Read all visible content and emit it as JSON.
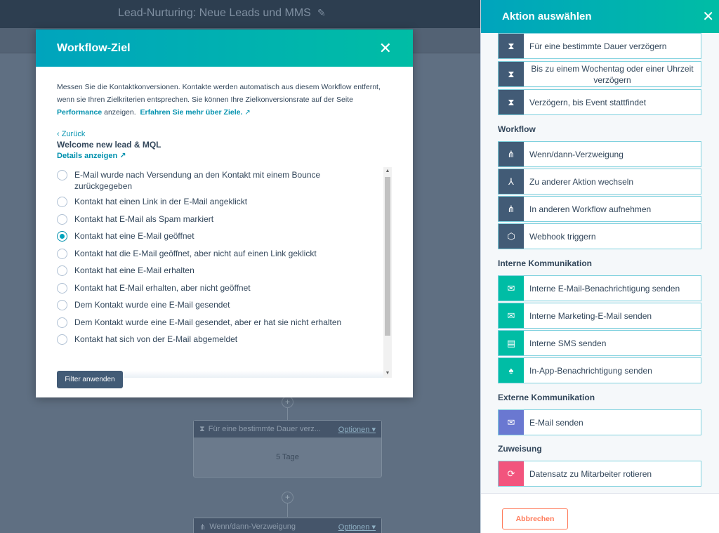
{
  "app": {
    "workflow_title": "Lead-Nurturing: Neue Leads und MMS",
    "edit_icon": "pencil-icon"
  },
  "canvas": {
    "cards": [
      {
        "icon": "hourglass-icon",
        "title": "Für eine bestimmte Dauer verz...",
        "options_label": "Optionen ▾",
        "body": "5 Tage"
      },
      {
        "icon": "branch-icon",
        "title": "Wenn/dann-Verzweigung",
        "options_label": "Optionen ▾",
        "body": ""
      }
    ],
    "plus_glyph": "+"
  },
  "modal": {
    "title": "Workflow-Ziel",
    "close_glyph": "✕",
    "intro_part1": "Messen Sie die Kontaktkonversionen. Kontakte werden automatisch aus diesem Workflow entfernt, wenn sie Ihren Zielkriterien entsprechen. Sie können Ihre Zielkonversionsrate auf der Seite ",
    "performance_link": "Performance",
    "intro_part2": " anzeigen.",
    "learn_more_link": "Erfahren Sie mehr über Ziele.",
    "back_link": "‹ Zurück",
    "goal_name": "Welcome new lead & MQL",
    "details_link": "Details anzeigen",
    "options": [
      {
        "label": "E-Mail wurde nach Versendung an den Kontakt mit einem Bounce zurückgegeben",
        "checked": false
      },
      {
        "label": "Kontakt hat einen Link in der E-Mail angeklickt",
        "checked": false
      },
      {
        "label": "Kontakt hat E-Mail als Spam markiert",
        "checked": false
      },
      {
        "label": "Kontakt hat eine E-Mail geöffnet",
        "checked": true
      },
      {
        "label": "Kontakt hat die E-Mail geöffnet, aber nicht auf einen Link geklickt",
        "checked": false
      },
      {
        "label": "Kontakt hat eine E-Mail erhalten",
        "checked": false
      },
      {
        "label": "Kontakt hat E-Mail erhalten, aber nicht geöffnet",
        "checked": false
      },
      {
        "label": "Dem Kontakt wurde eine E-Mail gesendet",
        "checked": false
      },
      {
        "label": "Dem Kontakt wurde eine E-Mail gesendet, aber er hat sie nicht erhalten",
        "checked": false
      },
      {
        "label": "Kontakt hat sich von der E-Mail abgemeldet",
        "checked": false
      }
    ],
    "apply_button": "Filter anwenden"
  },
  "panel": {
    "title": "Aktion auswählen",
    "close_glyph": "✕",
    "delay_actions": [
      {
        "label": "Für eine bestimmte Dauer verzögern",
        "icon": "hourglass-icon",
        "glyph": "⧗",
        "style": "dark"
      },
      {
        "label": "Bis zu einem Wochentag oder einer Uhrzeit verzögern",
        "icon": "hourglass-icon",
        "glyph": "⧗",
        "style": "dark"
      },
      {
        "label": "Verzögern, bis Event stattfindet",
        "icon": "hourglass-icon",
        "glyph": "⧗",
        "style": "dark"
      }
    ],
    "sections": [
      {
        "title": "Workflow",
        "items": [
          {
            "label": "Wenn/dann-Verzweigung",
            "icon": "branch-icon",
            "glyph": "⋔",
            "style": "dark"
          },
          {
            "label": "Zu anderer Aktion wechseln",
            "icon": "goto-icon",
            "glyph": "⅄",
            "style": "dark"
          },
          {
            "label": "In anderen Workflow aufnehmen",
            "icon": "enroll-workflow-icon",
            "glyph": "⋔",
            "style": "dark"
          },
          {
            "label": "Webhook triggern",
            "icon": "webhook-cube-icon",
            "glyph": "⬡",
            "style": "dark"
          }
        ]
      },
      {
        "title": "Interne Kommunikation",
        "items": [
          {
            "label": "Interne E-Mail-Benachrichtigung senden",
            "icon": "email-icon",
            "glyph": "✉",
            "style": "teal"
          },
          {
            "label": "Interne Marketing-E-Mail senden",
            "icon": "email-icon",
            "glyph": "✉",
            "style": "teal"
          },
          {
            "label": "Interne SMS senden",
            "icon": "sms-icon",
            "glyph": "▤",
            "style": "teal"
          },
          {
            "label": "In-App-Benachrichtigung senden",
            "icon": "bell-icon",
            "glyph": "♠",
            "style": "teal"
          }
        ]
      },
      {
        "title": "Externe Kommunikation",
        "items": [
          {
            "label": "E-Mail senden",
            "icon": "email-icon",
            "glyph": "✉",
            "style": "purple"
          }
        ]
      },
      {
        "title": "Zuweisung",
        "items": [
          {
            "label": "Datensatz zu Mitarbeiter rotieren",
            "icon": "rotate-owner-icon",
            "glyph": "⟳",
            "style": "pink"
          }
        ]
      }
    ],
    "cancel_button": "Abbrechen"
  },
  "colors": {
    "accent_teal": "#00a4bd",
    "accent_green": "#00bda5",
    "dark_icon": "#425b76",
    "purple_icon": "#6a78d1",
    "pink_icon": "#f2547d",
    "cancel_orange": "#ff7a59"
  }
}
